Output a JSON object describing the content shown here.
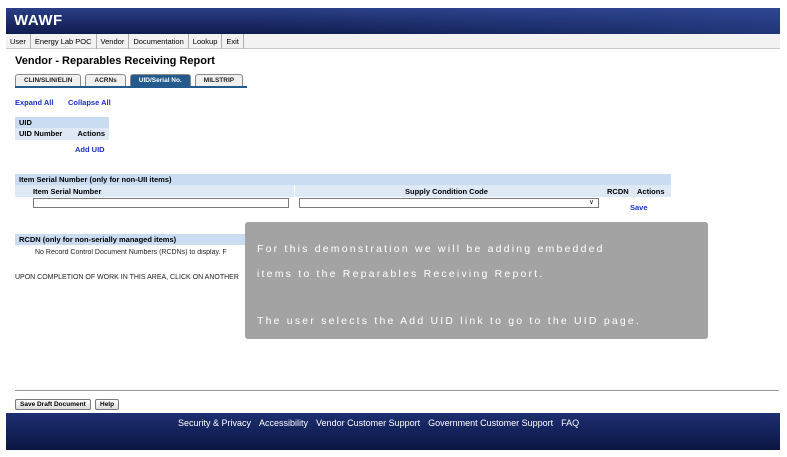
{
  "app": {
    "logo": "WAWF"
  },
  "menu": [
    "User",
    "Energy Lab POC",
    "Vendor",
    "Documentation",
    "Lookup",
    "Exit"
  ],
  "page_title": "Vendor - Reparables Receiving Report",
  "tabs": [
    {
      "label": "CLIN/SLIN/ELIN",
      "active": false
    },
    {
      "label": "ACRNs",
      "active": false
    },
    {
      "label": "UID/Serial No.",
      "active": true
    },
    {
      "label": "MILSTRIP",
      "active": false
    }
  ],
  "links": {
    "expand_all": "Expand All",
    "collapse_all": "Collapse All"
  },
  "uid_section": {
    "header": "UID",
    "col_number": "UID Number",
    "col_actions": "Actions",
    "add_link": "Add UID"
  },
  "serial_section": {
    "header": "Item Serial Number (only for non-UII items)",
    "col_serial": "Item Serial Number",
    "col_condition": "Supply Condition Code",
    "col_rcdn": "RCDN",
    "col_actions": "Actions",
    "serial_value": "",
    "condition_value": "",
    "save_link": "Save"
  },
  "rcdn_section": {
    "header": "RCDN (only for non-serially managed items)",
    "message": "No Record Control Document Numbers (RCDNs) to display. F"
  },
  "completion_text": "UPON COMPLETION OF WORK IN THIS AREA, CLICK ON ANOTHER",
  "buttons": {
    "save_draft": "Save Draft Document",
    "help": "Help"
  },
  "footer": [
    "Security & Privacy",
    "Accessibility",
    "Vendor Customer Support",
    "Government Customer Support",
    "FAQ"
  ],
  "overlay": {
    "line1": "For this demonstration we will be adding embedded",
    "line2": "items to the Reparables Receiving Report.",
    "line3": "The user selects the Add UID link to go to the UID page."
  }
}
